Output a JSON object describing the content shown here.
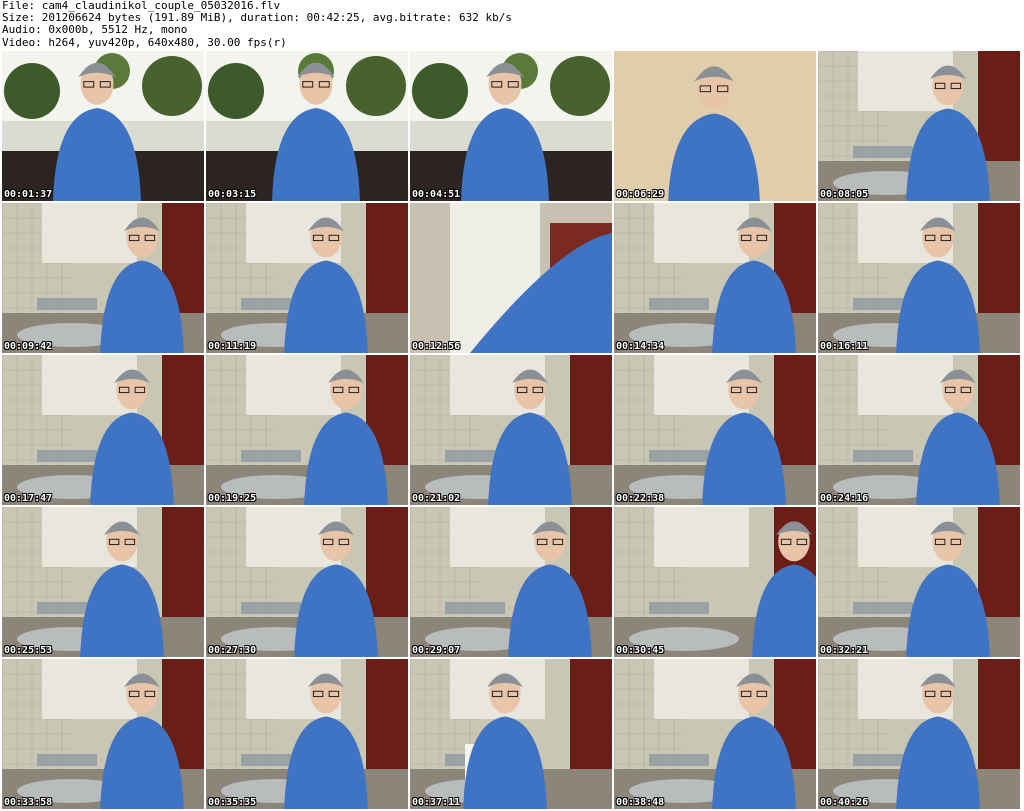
{
  "header": {
    "file_line": "File: cam4_claudinikol_couple_05032016.flv",
    "size_line": "Size: 201206624 bytes (191.89 MiB), duration: 00:42:25, avg.bitrate: 632 kb/s",
    "audio_line": "Audio: 0x000b, 5512 Hz, mono",
    "video_line": "Video: h264, yuv420p, 640x480, 30.00 fps(r)"
  },
  "colors": {
    "hoodie": "#3f74c4",
    "beanie": "#8a9096",
    "tiles": "#c9c6b4",
    "cabinet": "#e9e6de",
    "curtain": "#6b1e17"
  },
  "thumbnails": [
    {
      "timestamp": "00:01:37",
      "scene": "plants"
    },
    {
      "timestamp": "00:03:15",
      "scene": "plants"
    },
    {
      "timestamp": "00:04:51",
      "scene": "plants"
    },
    {
      "timestamp": "00:06:29",
      "scene": "wall"
    },
    {
      "timestamp": "00:08:05",
      "scene": "kitchen-close"
    },
    {
      "timestamp": "00:09:42",
      "scene": "kitchen-close"
    },
    {
      "timestamp": "00:11:19",
      "scene": "kitchen"
    },
    {
      "timestamp": "00:12:56",
      "scene": "blur"
    },
    {
      "timestamp": "00:14:34",
      "scene": "sink"
    },
    {
      "timestamp": "00:16:11",
      "scene": "sink"
    },
    {
      "timestamp": "00:17:47",
      "scene": "sink"
    },
    {
      "timestamp": "00:19:25",
      "scene": "sink"
    },
    {
      "timestamp": "00:21:02",
      "scene": "sink"
    },
    {
      "timestamp": "00:22:38",
      "scene": "sink"
    },
    {
      "timestamp": "00:24:16",
      "scene": "sink"
    },
    {
      "timestamp": "00:25:53",
      "scene": "sink"
    },
    {
      "timestamp": "00:27:30",
      "scene": "sink"
    },
    {
      "timestamp": "00:29:07",
      "scene": "sink"
    },
    {
      "timestamp": "00:30:45",
      "scene": "sink-away"
    },
    {
      "timestamp": "00:32:21",
      "scene": "sink"
    },
    {
      "timestamp": "00:33:58",
      "scene": "sink"
    },
    {
      "timestamp": "00:35:35",
      "scene": "sink"
    },
    {
      "timestamp": "00:37:11",
      "scene": "sink-towel"
    },
    {
      "timestamp": "00:38:48",
      "scene": "sink"
    },
    {
      "timestamp": "00:40:26",
      "scene": "sink"
    }
  ]
}
